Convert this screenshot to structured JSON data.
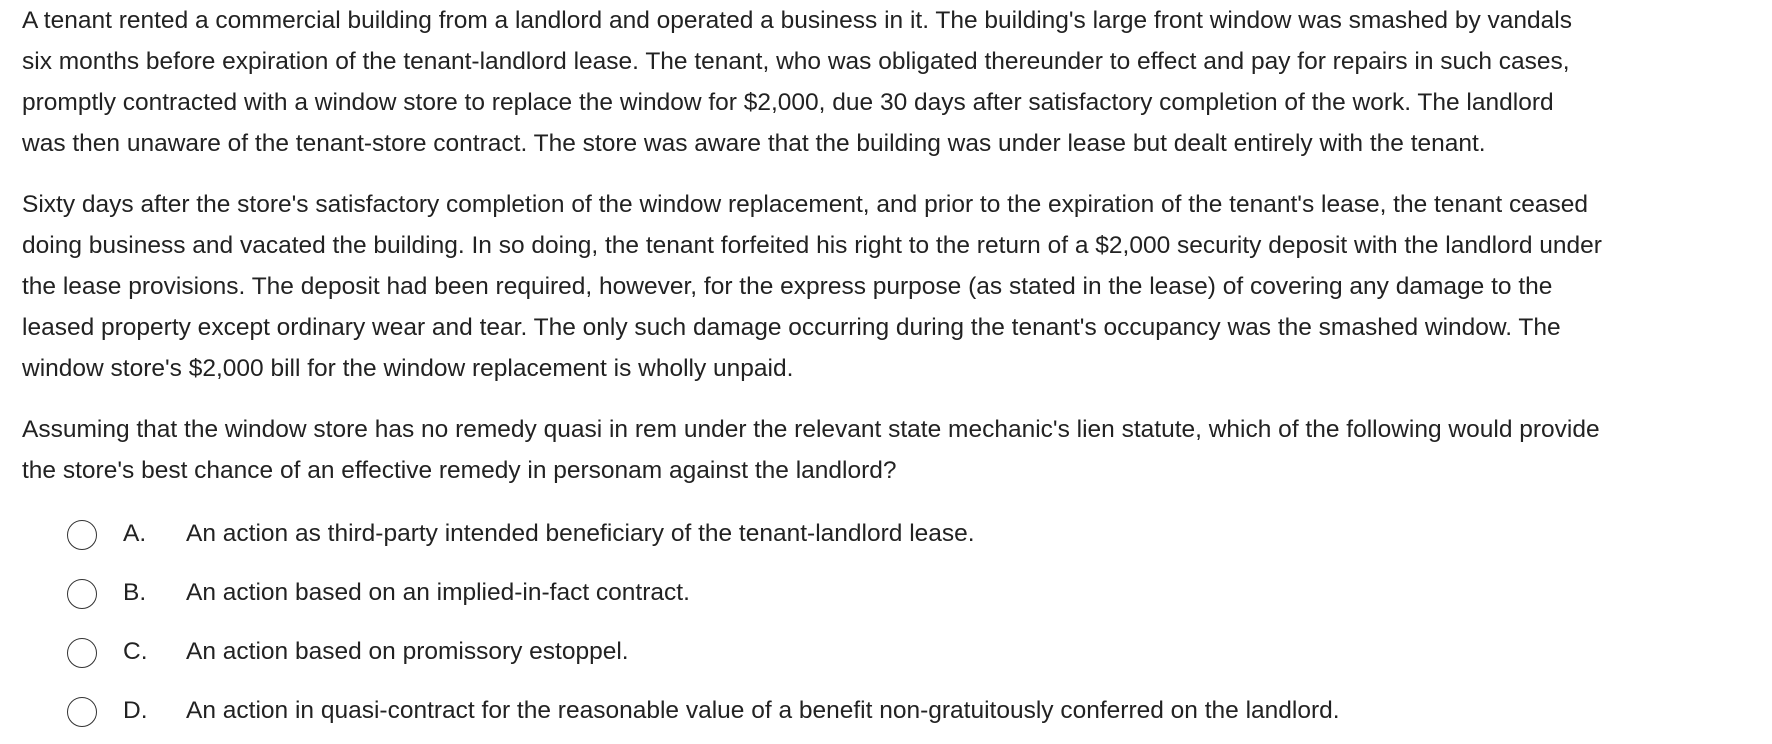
{
  "question": {
    "paragraphs": [
      {
        "lines": [
          "A tenant rented a commercial building from a landlord and operated a business in it.  The building's large front window was smashed by vandals",
          "six months before expiration of the tenant-landlord lease.  The tenant, who was obligated thereunder to effect and pay for repairs in such cases,",
          "promptly contracted with a window store to replace the window for $2,000, due 30 days after satisfactory completion of the work.  The landlord",
          "was then unaware of the tenant-store contract.  The store was aware that the building was under lease but dealt entirely with the tenant."
        ]
      },
      {
        "lines": [
          "Sixty days after the store's satisfactory completion of the window replacement, and prior to the expiration of the tenant's lease, the tenant ceased",
          "doing business and vacated the building.  In so doing, the tenant forfeited his right to the return of a $2,000 security deposit with the landlord under",
          "the lease provisions.  The deposit had been required, however, for the express purpose (as stated in the lease) of covering any damage to the",
          "leased property except ordinary wear and tear.  The only such damage occurring during the tenant's occupancy was the smashed window.  The",
          "window store's $2,000 bill for the window replacement is wholly unpaid."
        ]
      },
      {
        "lines": [
          "Assuming that the window store has no remedy quasi in rem under the relevant state mechanic's lien statute, which of the following would provide",
          "the store's best chance of an effective remedy in personam against the landlord?"
        ]
      }
    ]
  },
  "options": [
    {
      "letter": "A.",
      "text": "An action as third-party intended beneficiary of the tenant-landlord lease.",
      "selected": false
    },
    {
      "letter": "B.",
      "text": "An action based on an implied-in-fact contract.",
      "selected": false
    },
    {
      "letter": "C.",
      "text": "An action based on promissory estoppel.",
      "selected": false
    },
    {
      "letter": "D.",
      "text": "An action in quasi-contract for the reasonable value of a benefit non-gratuitously conferred on the landlord.",
      "selected": false
    }
  ]
}
